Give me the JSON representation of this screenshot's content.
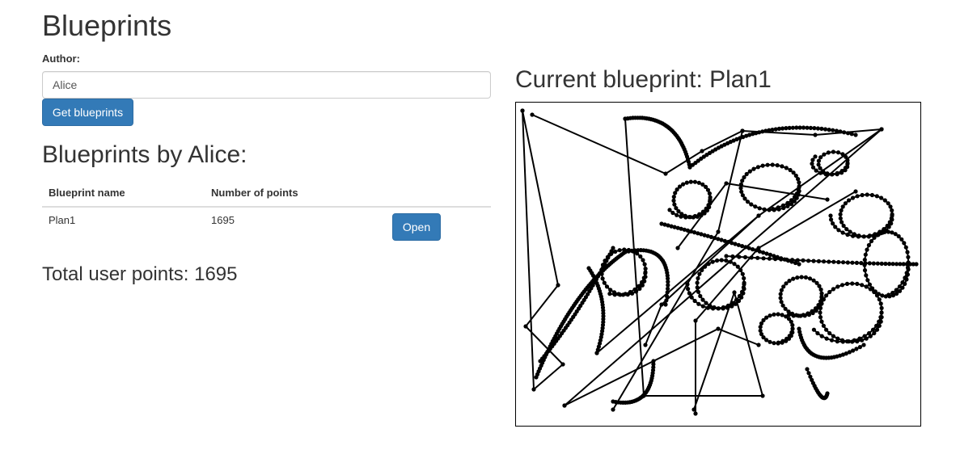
{
  "page": {
    "title": "Blueprints"
  },
  "form": {
    "author_label": "Author:",
    "author_value": "Alice",
    "get_button": "Get blueprints"
  },
  "list": {
    "heading": "Blueprints by Alice:",
    "columns": [
      "Blueprint name",
      "Number of points",
      ""
    ],
    "rows": [
      {
        "name": "Plan1",
        "points": "1695",
        "action": "Open"
      }
    ],
    "total_label": "Total user points: 1695"
  },
  "current": {
    "heading": "Current blueprint: Plan1",
    "stroke_color": "#000000"
  }
}
